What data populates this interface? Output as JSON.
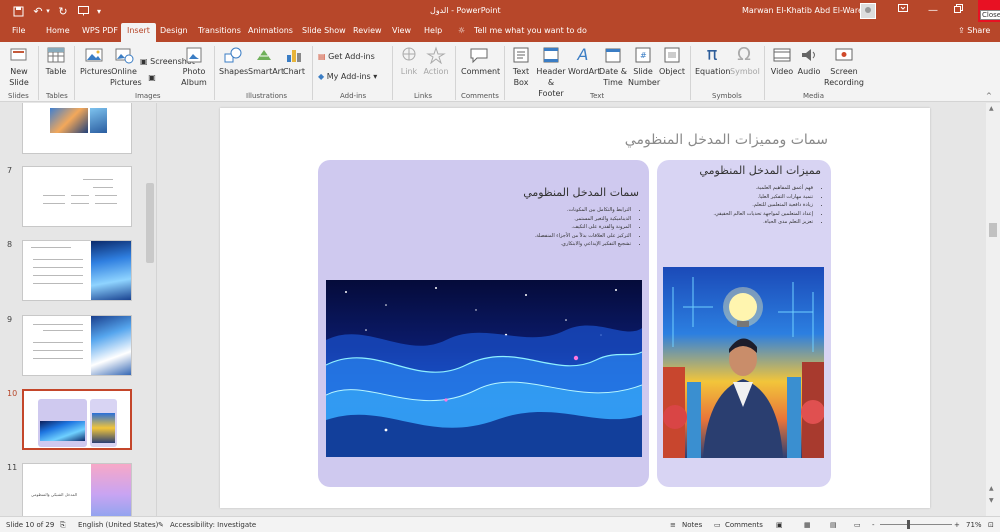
{
  "window": {
    "file_title": "الدول",
    "app_name": "PowerPoint",
    "title_sep": " - ",
    "user_name": "Marwan El-Khatib Abd El-Wares",
    "close_tooltip": "Close"
  },
  "tabs": [
    "File",
    "Home",
    "WPS PDF",
    "Insert",
    "Design",
    "Transitions",
    "Animations",
    "Slide Show",
    "Review",
    "View",
    "Help"
  ],
  "active_tab": "Insert",
  "tell_me": "Tell me what you want to do",
  "share_label": "Share",
  "ribbon": {
    "new_slide": "New Slide",
    "table": "Table",
    "pictures": "Pictures",
    "online_pictures": "Online Pictures",
    "screenshot": "Screenshot",
    "photo_album": "Photo Album",
    "shapes": "Shapes",
    "smartart": "SmartArt",
    "chart": "Chart",
    "get_addins": "Get Add-ins",
    "my_addins": "My Add-ins",
    "link": "Link",
    "action": "Action",
    "comment": "Comment",
    "text_box": "Text Box",
    "header_footer": "Header & Footer",
    "wordart": "WordArt",
    "date_time": "Date & Time",
    "slide_number": "Slide Number",
    "object": "Object",
    "equation": "Equation",
    "symbol": "Symbol",
    "video": "Video",
    "audio": "Audio",
    "screen_recording": "Screen Recording",
    "groups": [
      "Slides",
      "Tables",
      "Images",
      "Illustrations",
      "Add-ins",
      "Links",
      "Comments",
      "Text",
      "Symbols",
      "Media"
    ]
  },
  "thumbnails": [
    {
      "num": "7"
    },
    {
      "num": "8"
    },
    {
      "num": "9"
    },
    {
      "num": "10"
    },
    {
      "num": "11"
    }
  ],
  "thumb11_title": "المدخل الشبكي والمنظومي",
  "slide": {
    "title": "سمات وممیزات المدخل المنظومي",
    "left_card": {
      "title": "سمات المدخل المنظومي",
      "bullets": [
        "الترابط والتكامل بين المكونات.",
        "الديناميكية والتغير المستمر.",
        "المرونة والقدرة على التكيف.",
        "التركيز على العلاقات بدلاً من الأجزاء المنفصلة.",
        "تشجيع التفكير الإبداعي والابتكاري."
      ]
    },
    "right_card": {
      "title": "ممیزات المدخل المنظومي",
      "bullets": [
        "فهم أعمق للمفاهيم العلمية.",
        "تنمية مهارات التفكير العليا.",
        "زيادة دافعية المتعلمين للتعلم.",
        "إعداد المتعلمين لمواجهة تحديات العالم الحقيقي.",
        "تعزيز التعلم مدى الحياة."
      ]
    }
  },
  "status": {
    "slide_info": "Slide 10 of 29",
    "language": "English (United States)",
    "accessibility": "Accessibility: Investigate",
    "notes": "Notes",
    "comments": "Comments",
    "zoom": "71%",
    "zoom_minus": "-",
    "zoom_plus": "+"
  },
  "colors": {
    "accent": "#b7472a",
    "card_left": "#cfc9ef",
    "card_right": "#d8d4f3"
  }
}
